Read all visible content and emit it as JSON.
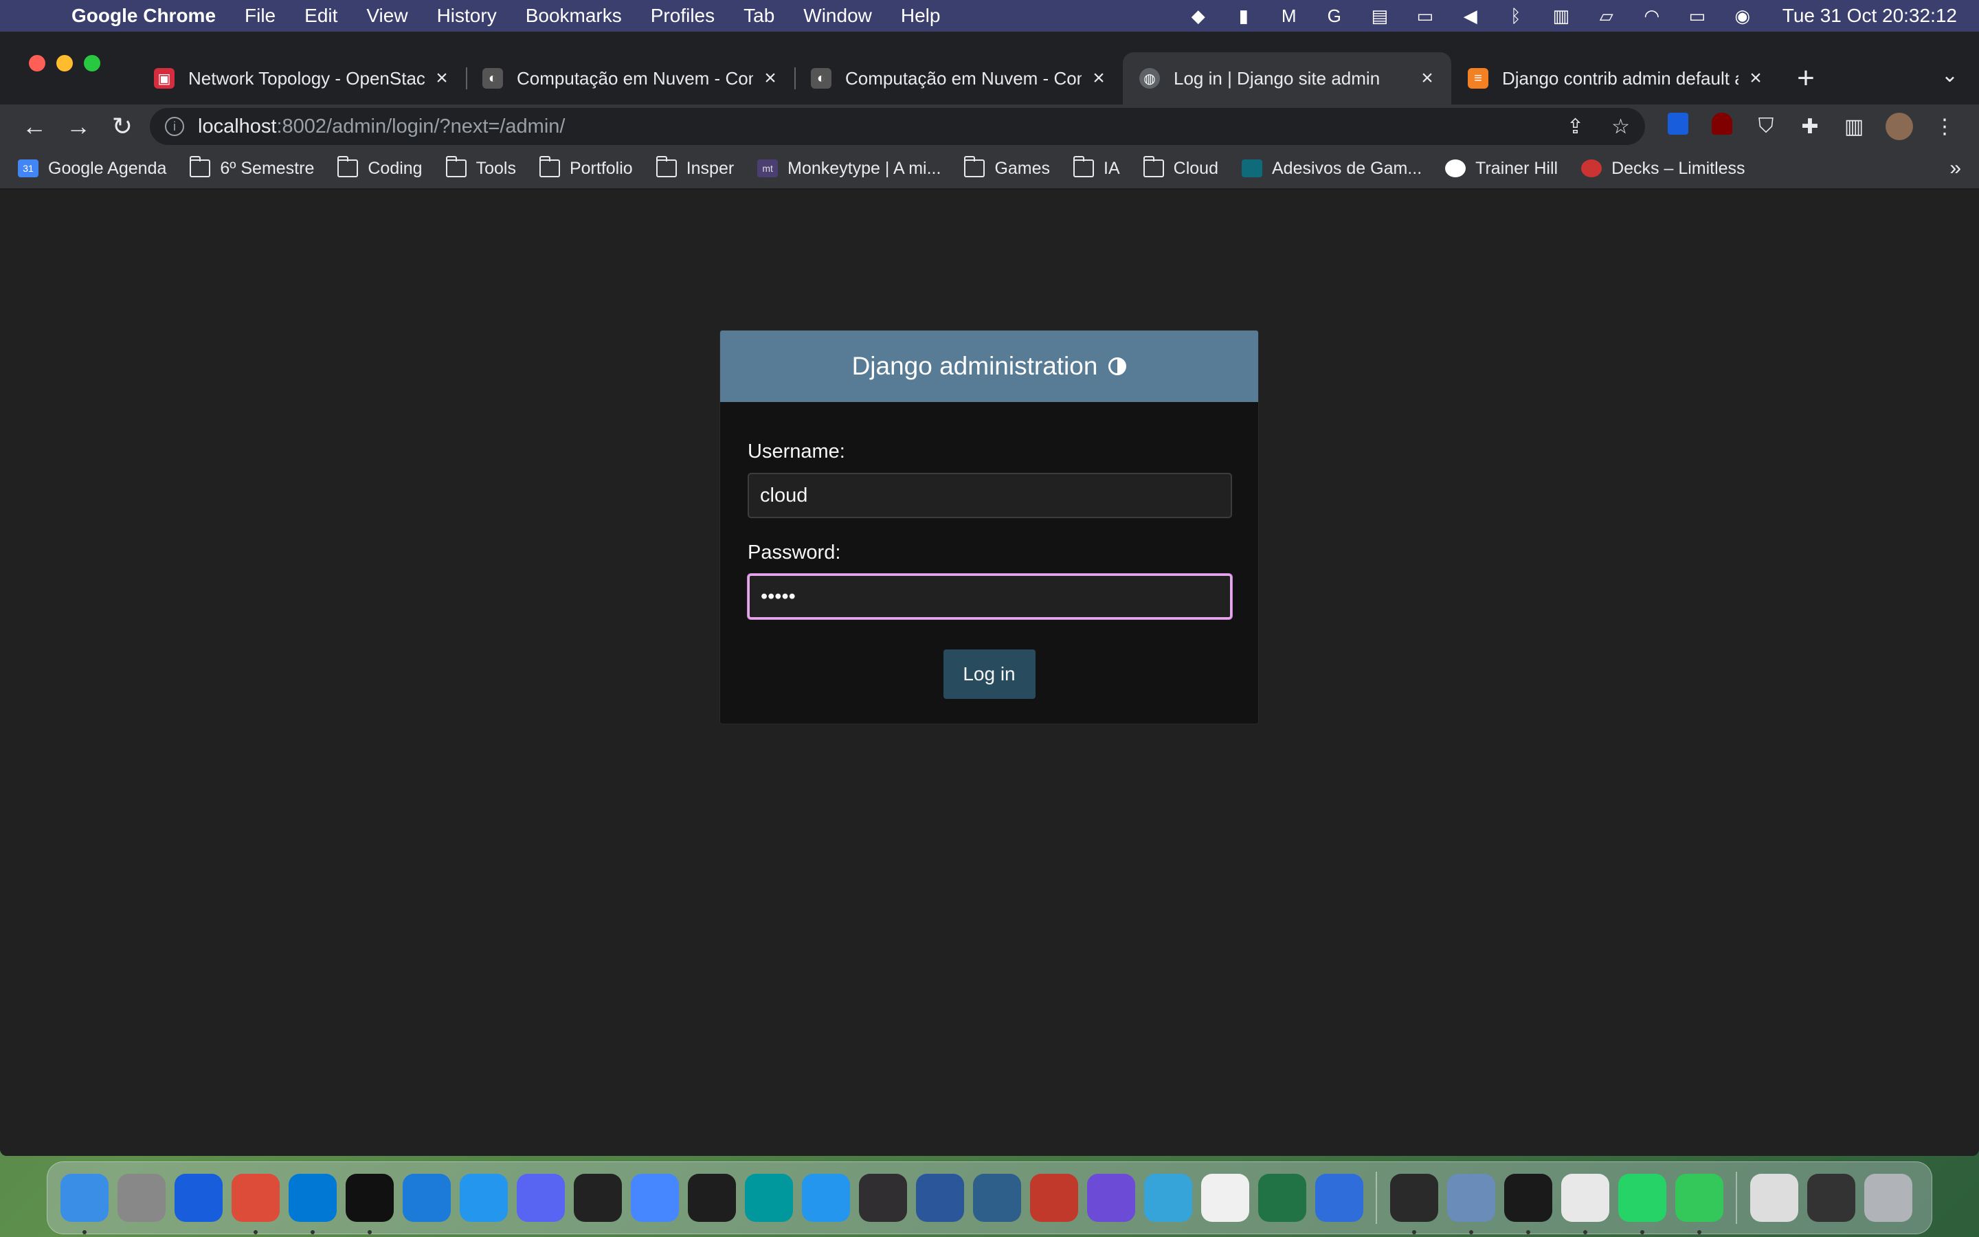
{
  "menubar": {
    "app_name": "Google Chrome",
    "items": [
      "File",
      "Edit",
      "View",
      "History",
      "Bookmarks",
      "Profiles",
      "Tab",
      "Window",
      "Help"
    ],
    "clock": "Tue 31 Oct  20:32:12"
  },
  "tabs": [
    {
      "title": "Network Topology - OpenStack",
      "favicon_color": "#d42d3d",
      "active": false
    },
    {
      "title": "Computação em Nuvem - Computação",
      "favicon_color": "#555555",
      "active": false
    },
    {
      "title": "Computação em Nuvem - Computação",
      "favicon_color": "#555555",
      "active": false
    },
    {
      "title": "Log in | Django site admin",
      "favicon_color": "#5f6368",
      "active": true
    },
    {
      "title": "Django contrib admin default a",
      "favicon_color": "#f48024",
      "active": false
    }
  ],
  "toolbar": {
    "url_host": "localhost",
    "url_rest": ":8002/admin/login/?next=/admin/"
  },
  "bookmarks": [
    {
      "label": "Google Agenda",
      "icon": "calendar-icon"
    },
    {
      "label": "6º Semestre",
      "icon": "folder-icon"
    },
    {
      "label": "Coding",
      "icon": "folder-icon"
    },
    {
      "label": "Tools",
      "icon": "folder-icon"
    },
    {
      "label": "Portfolio",
      "icon": "folder-icon"
    },
    {
      "label": "Insper",
      "icon": "folder-icon"
    },
    {
      "label": "Monkeytype | A mi...",
      "icon": "monkeytype-icon"
    },
    {
      "label": "Games",
      "icon": "folder-icon"
    },
    {
      "label": "IA",
      "icon": "folder-icon"
    },
    {
      "label": "Cloud",
      "icon": "folder-icon"
    },
    {
      "label": "Adesivos de Gam...",
      "icon": "website-icon"
    },
    {
      "label": "Trainer Hill",
      "icon": "trainer-hill-icon"
    },
    {
      "label": "Decks – Limitless",
      "icon": "limitless-icon"
    }
  ],
  "login": {
    "header": "Django administration",
    "username_label": "Username:",
    "username_value": "cloud",
    "password_label": "Password:",
    "password_value": "•••••",
    "submit_label": "Log in"
  },
  "colors": {
    "header_bg": "#587b96",
    "button_bg": "#284b5e",
    "focus_border": "#e3a9e8",
    "page_bg": "#212121"
  },
  "dock": [
    {
      "name": "finder",
      "color": "#3a8ee6",
      "running": true
    },
    {
      "name": "launchpad",
      "color": "#888888",
      "running": false
    },
    {
      "name": "bitwarden",
      "color": "#175ddc",
      "running": false
    },
    {
      "name": "chrome",
      "color": "#dd4b39",
      "running": true
    },
    {
      "name": "vscode",
      "color": "#0078d4",
      "running": true
    },
    {
      "name": "terminal-ish",
      "color": "#111111",
      "running": true
    },
    {
      "name": "xcode",
      "color": "#1c7ad8",
      "running": false
    },
    {
      "name": "docker-desktop",
      "color": "#2496ed",
      "running": false
    },
    {
      "name": "discord",
      "color": "#5865f2",
      "running": false
    },
    {
      "name": "logitech",
      "color": "#222222",
      "running": false
    },
    {
      "name": "nordvpn",
      "color": "#4687ff",
      "running": false
    },
    {
      "name": "figma",
      "color": "#1e1e1e",
      "running": false
    },
    {
      "name": "arduino",
      "color": "#00979d",
      "running": false
    },
    {
      "name": "docker",
      "color": "#2496ed",
      "running": false
    },
    {
      "name": "obs",
      "color": "#302e31",
      "running": false
    },
    {
      "name": "word",
      "color": "#2b579a",
      "running": false
    },
    {
      "name": "mysql-workbench",
      "color": "#2d5f8a",
      "running": false
    },
    {
      "name": "joystick",
      "color": "#c0392b",
      "running": false
    },
    {
      "name": "beekeeper",
      "color": "#6c4bd6",
      "running": false
    },
    {
      "name": "dolphin",
      "color": "#36a3d9",
      "running": false
    },
    {
      "name": "clock",
      "color": "#f0f0f0",
      "running": false
    },
    {
      "name": "excel",
      "color": "#217346",
      "running": false
    },
    {
      "name": "malwarebytes",
      "color": "#2f6ddb",
      "running": false
    },
    {
      "name": "epic-games",
      "color": "#2a2a2a",
      "running": true
    },
    {
      "name": "preview",
      "color": "#6a8cb8",
      "running": true
    },
    {
      "name": "terminal",
      "color": "#1a1a1a",
      "running": true
    },
    {
      "name": "textedit",
      "color": "#e8e8e8",
      "running": true
    },
    {
      "name": "whatsapp",
      "color": "#25d366",
      "running": true
    },
    {
      "name": "numbers",
      "color": "#34c759",
      "running": true
    },
    {
      "name": "document",
      "color": "#dddddd",
      "running": false
    },
    {
      "name": "chrome-window",
      "color": "#333333",
      "running": false
    },
    {
      "name": "trash",
      "color": "#b0b4b8",
      "running": false
    }
  ]
}
